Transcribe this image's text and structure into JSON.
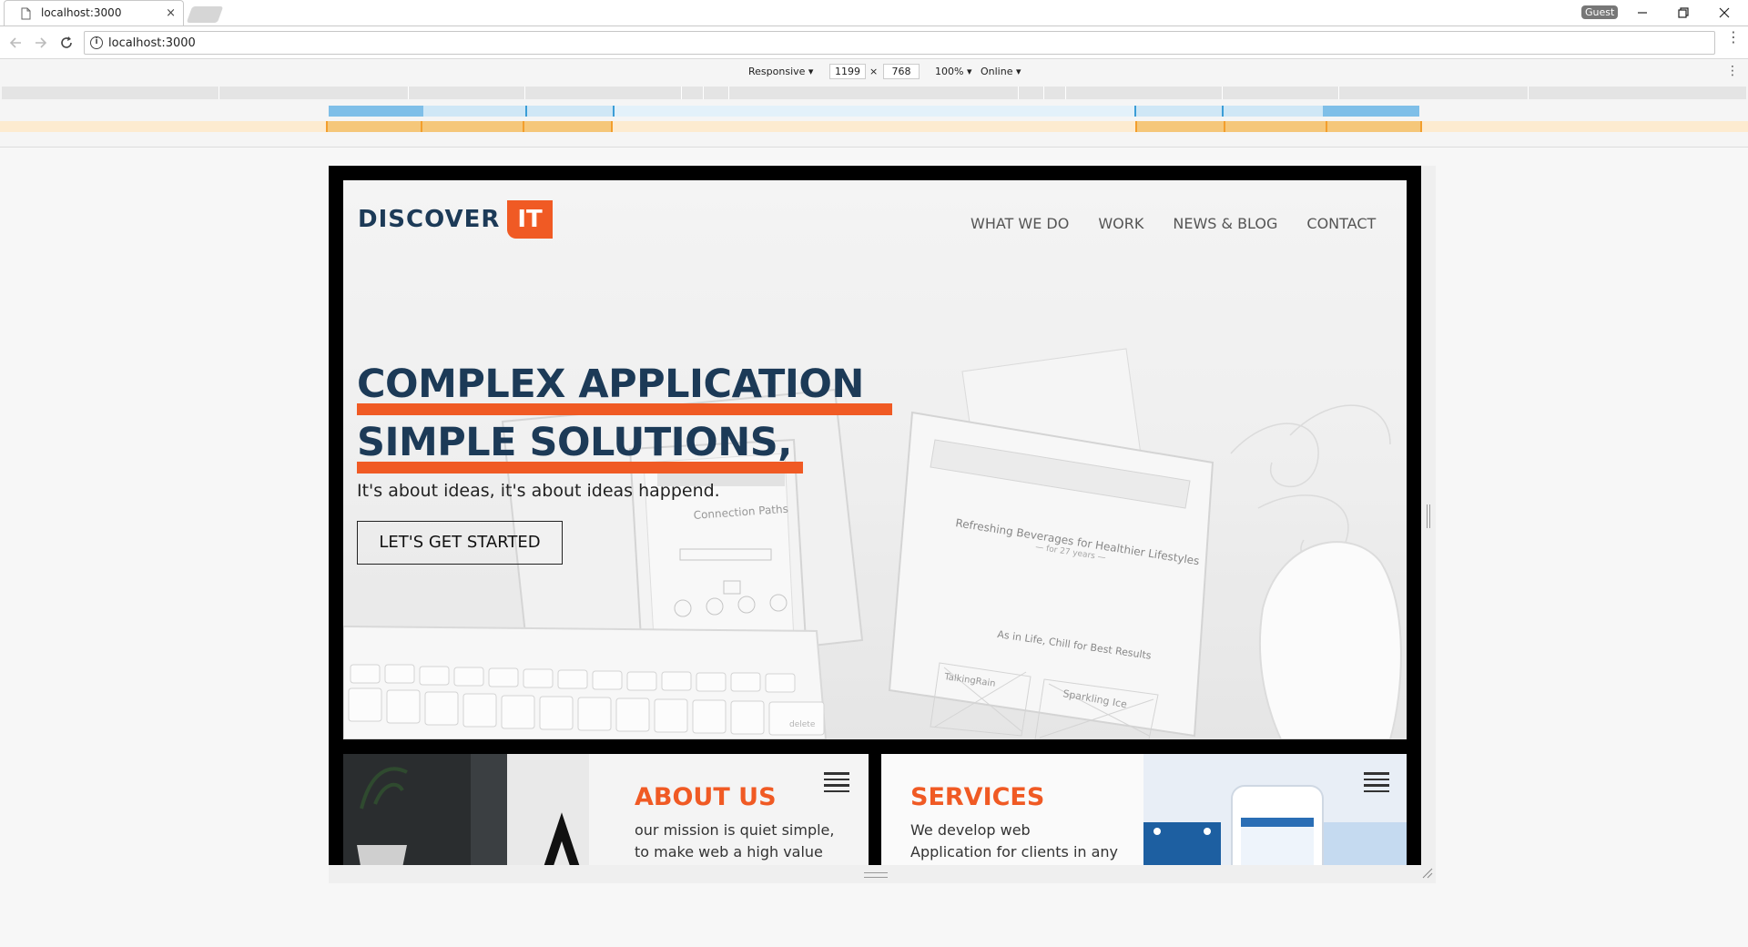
{
  "browser": {
    "tab_title": "localhost:3000",
    "tab_close": "×",
    "profile": "Guest",
    "url": "localhost:3000",
    "window_controls": [
      "minimize-icon",
      "restore-icon",
      "close-icon"
    ]
  },
  "device_toolbar": {
    "device": "Responsive ▾",
    "width": "1199",
    "times": "×",
    "height": "768",
    "zoom": "100% ▾",
    "network": "Online ▾"
  },
  "site": {
    "logo": {
      "word": "DISCOVER",
      "badge": "IT"
    },
    "nav": [
      "WHAT WE DO",
      "WORK",
      "NEWS & BLOG",
      "CONTACT"
    ],
    "hero": {
      "headline_line1": "COMPLEX APPLICATION",
      "headline_line2": "SIMPLE SOLUTIONS,",
      "subtitle": "It's about ideas, it's about ideas happend.",
      "cta": "LET'S GET STARTED"
    },
    "cards": {
      "about": {
        "title": "ABOUT US",
        "line1": "our mission is quiet simple,",
        "line2": "to make web a high value"
      },
      "services": {
        "title": "SERVICES",
        "line1": "We develop web",
        "line2": "Application for clients in any"
      }
    },
    "mockup_text": {
      "refreshing": "Refreshing Beverages for Healthier Lifestyles",
      "years": "— for 27 years —",
      "chill": "As in Life, Chill for Best Results",
      "talking": "TalkingRain",
      "sparkling": "Sparkling Ice",
      "connection": "Connection Paths",
      "delete_key": "delete"
    },
    "colors": {
      "brand_navy": "#1c3a57",
      "brand_orange": "#f05a24"
    }
  }
}
